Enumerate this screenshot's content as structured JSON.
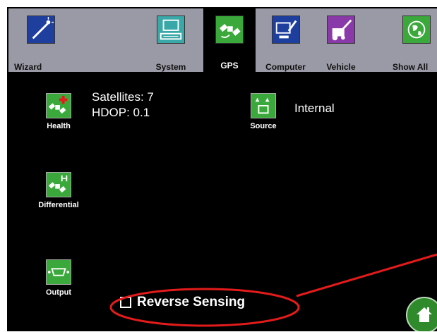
{
  "tabs": [
    {
      "label": "Wizard",
      "icon": "wand-icon",
      "active": false
    },
    {
      "label": "System",
      "icon": "computer-keyboard-icon",
      "active": false
    },
    {
      "label": "GPS",
      "icon": "satellite-icon",
      "active": true
    },
    {
      "label": "Computer",
      "icon": "computer-wrench-icon",
      "active": false
    },
    {
      "label": "Vehicle",
      "icon": "vehicle-wrench-icon",
      "active": false
    },
    {
      "label": "Show All",
      "icon": "globe-icon",
      "active": false
    }
  ],
  "settings": {
    "health": {
      "label": "Health",
      "icon": "satellite-health-icon"
    },
    "differential": {
      "label": "Differential",
      "icon": "satellite-differential-icon"
    },
    "output": {
      "label": "Output",
      "icon": "serial-port-icon"
    },
    "source": {
      "label": "Source",
      "icon": "antenna-source-icon"
    }
  },
  "status": {
    "satellites": "Satellites: 7",
    "hdop": "HDOP: 0.1",
    "source_value": "Internal"
  },
  "reverse_sensing": {
    "label": "Reverse Sensing",
    "checked": false
  },
  "home_button": {
    "icon": "home-icon"
  },
  "colors": {
    "annotation": "#e31b1b",
    "icon_green": "#3aa83a",
    "screen_bg": "#000000",
    "tabbar_bg": "#9a9aa6"
  }
}
